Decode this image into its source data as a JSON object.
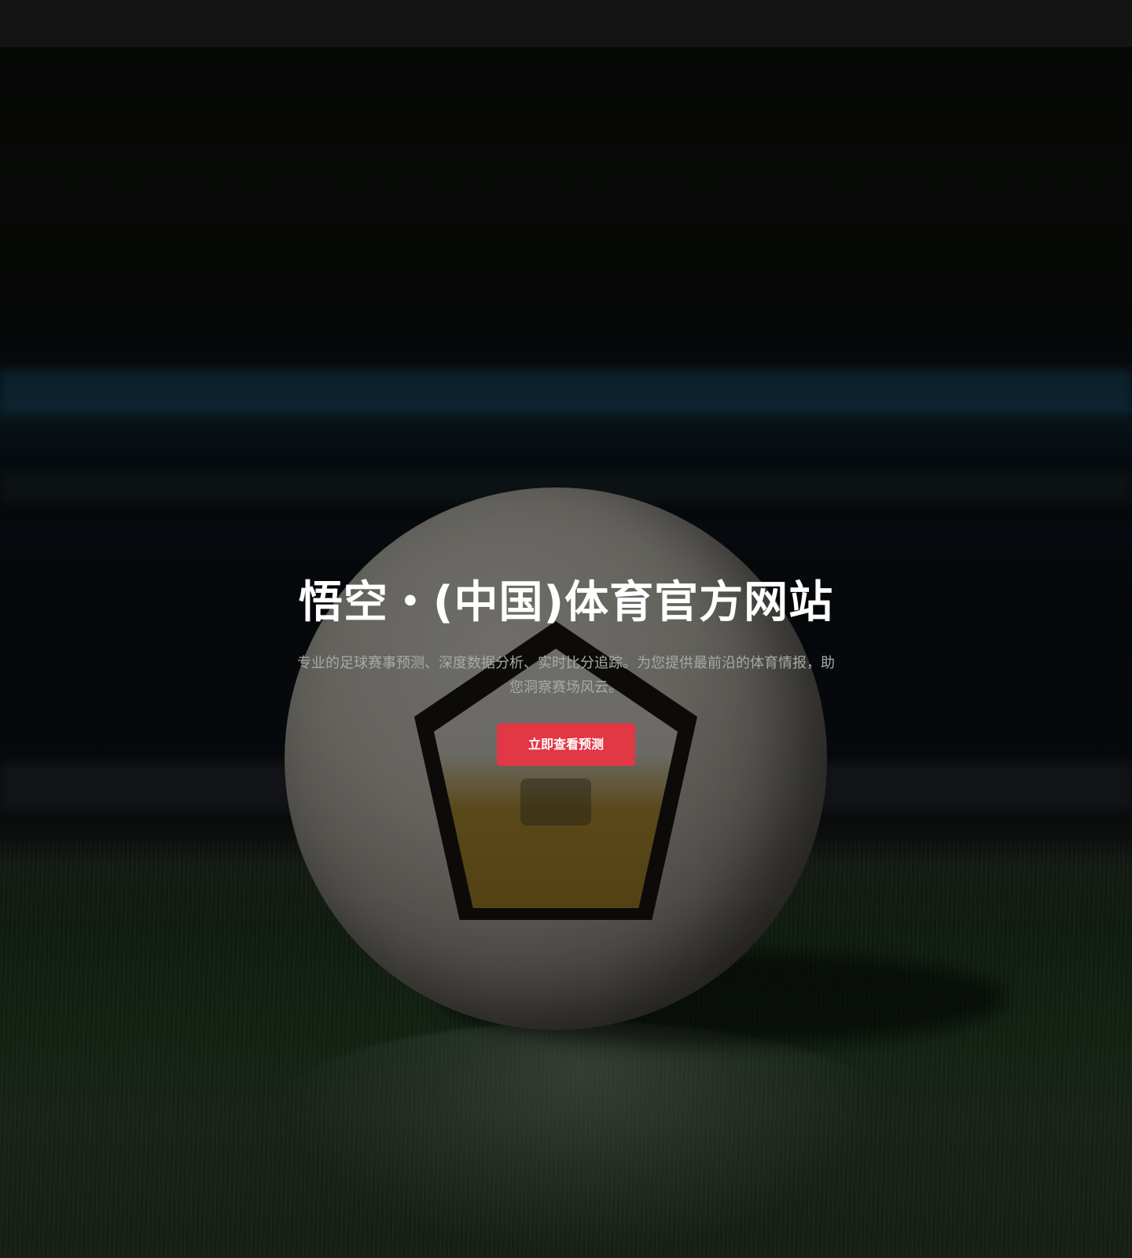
{
  "hero": {
    "title": "悟空・(中国)体育官方网站",
    "subtitle": "专业的足球赛事预测、深度数据分析、实时比分追踪。为您提供最前沿的体育情报，助您洞察赛场风云。",
    "cta_label": "立即查看预测"
  },
  "colors": {
    "topbar_bg": "#141414",
    "accent": "#e23744",
    "title_text": "#ffffff",
    "subtitle_text": "#a8aaa8"
  },
  "background_image": {
    "subject": "soccer-ball-on-grass"
  }
}
